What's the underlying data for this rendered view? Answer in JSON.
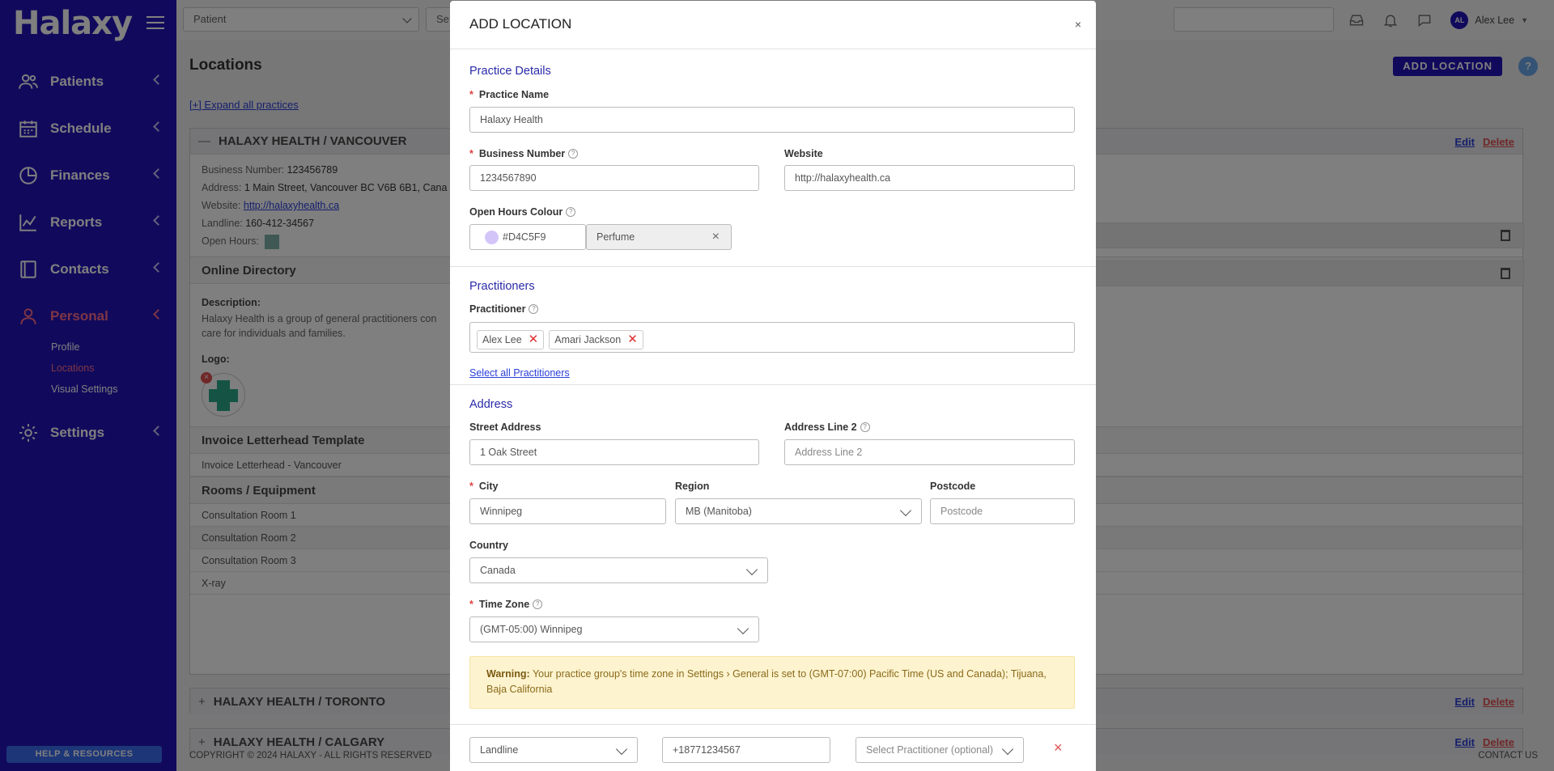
{
  "app": {
    "logo": "Halaxy",
    "help_label": "HELP & RESOURCES"
  },
  "nav": [
    {
      "label": "Patients",
      "icon": "users-icon"
    },
    {
      "label": "Schedule",
      "icon": "calendar-icon"
    },
    {
      "label": "Finances",
      "icon": "pie-chart-icon"
    },
    {
      "label": "Reports",
      "icon": "line-chart-icon"
    },
    {
      "label": "Contacts",
      "icon": "book-icon"
    },
    {
      "label": "Personal",
      "icon": "person-icon"
    },
    {
      "label": "Settings",
      "icon": "gear-icon"
    }
  ],
  "subnav": [
    "Profile",
    "Locations",
    "Visual Settings"
  ],
  "topbar": {
    "patient_select": "Patient",
    "search_stub": "Se",
    "user_initials": "AL",
    "user_name": "Alex Lee"
  },
  "page": {
    "title": "Locations",
    "add_button": "ADD LOCATION",
    "help": "?",
    "expand_all": "[+] Expand all practices",
    "vancouver": {
      "title": "HALAXY HEALTH / VANCOUVER",
      "business_number_label": "Business Number:",
      "business_number": "123456789",
      "address_label": "Address:",
      "address": "1 Main Street, Vancouver BC V6B 6B1, Cana",
      "website_label": "Website:",
      "website": "http://halaxyhealth.ca",
      "landline_label": "Landline:",
      "landline": "160-412-34567",
      "open_hours_label": "Open Hours:",
      "online_directory": "Online Directory",
      "description_label": "Description:",
      "description_1": "Halaxy Health is a group of general practitioners con",
      "description_2": "care for individuals and families.",
      "logo_label": "Logo:",
      "invoice_title": "Invoice Letterhead Template",
      "invoice_value": "Invoice Letterhead - Vancouver",
      "rooms_title": "Rooms / Equipment",
      "rooms": [
        "Consultation Room 1",
        "Consultation Room 2",
        "Consultation Room 3",
        "X-ray"
      ]
    },
    "toronto": "HALAXY HEALTH / TORONTO",
    "calgary": "HALAXY HEALTH / CALGARY",
    "edit": "Edit",
    "delete": "Delete",
    "footer_left": "COPYRIGHT © 2024 HALAXY - ALL RIGHTS RESERVED",
    "footer_right": "CONTACT US"
  },
  "modal": {
    "title": "ADD LOCATION",
    "close": "×",
    "practice_details": "Practice Details",
    "practice_name_label": "Practice Name",
    "practice_name": "Halaxy Health",
    "business_number_label": "Business Number",
    "business_number": "1234567890",
    "website_label": "Website",
    "website": "http://halaxyhealth.ca",
    "open_hours_label": "Open Hours Colour",
    "colour_hex": "#D4C5F9",
    "colour_name": "Perfume",
    "practitioners_title": "Practitioners",
    "practitioner_label": "Practitioner",
    "practitioners": [
      "Alex Lee",
      "Amari Jackson"
    ],
    "select_all": "Select all Practitioners",
    "address_title": "Address",
    "street_label": "Street Address",
    "street": "1 Oak Street",
    "line2_label": "Address Line 2",
    "line2_placeholder": "Address Line 2",
    "city_label": "City",
    "city": "Winnipeg",
    "region_label": "Region",
    "region": "MB (Manitoba)",
    "postcode_label": "Postcode",
    "postcode_placeholder": "Postcode",
    "country_label": "Country",
    "country": "Canada",
    "timezone_label": "Time Zone",
    "timezone": "(GMT-05:00) Winnipeg",
    "warning_bold": "Warning:",
    "warning_text": "Your practice group's time zone in Settings › General is set to (GMT-07:00) Pacific Time (US and Canada); Tijuana, Baja California",
    "phone_type": "Landline",
    "phone_number": "+18771234567",
    "phone_practitioner_placeholder": "Select Practitioner (optional)",
    "remove": "×"
  },
  "colors": {
    "sidebar": "#2214b8",
    "accent": "#ff6b8a",
    "swatch": "#D4C5F9"
  }
}
